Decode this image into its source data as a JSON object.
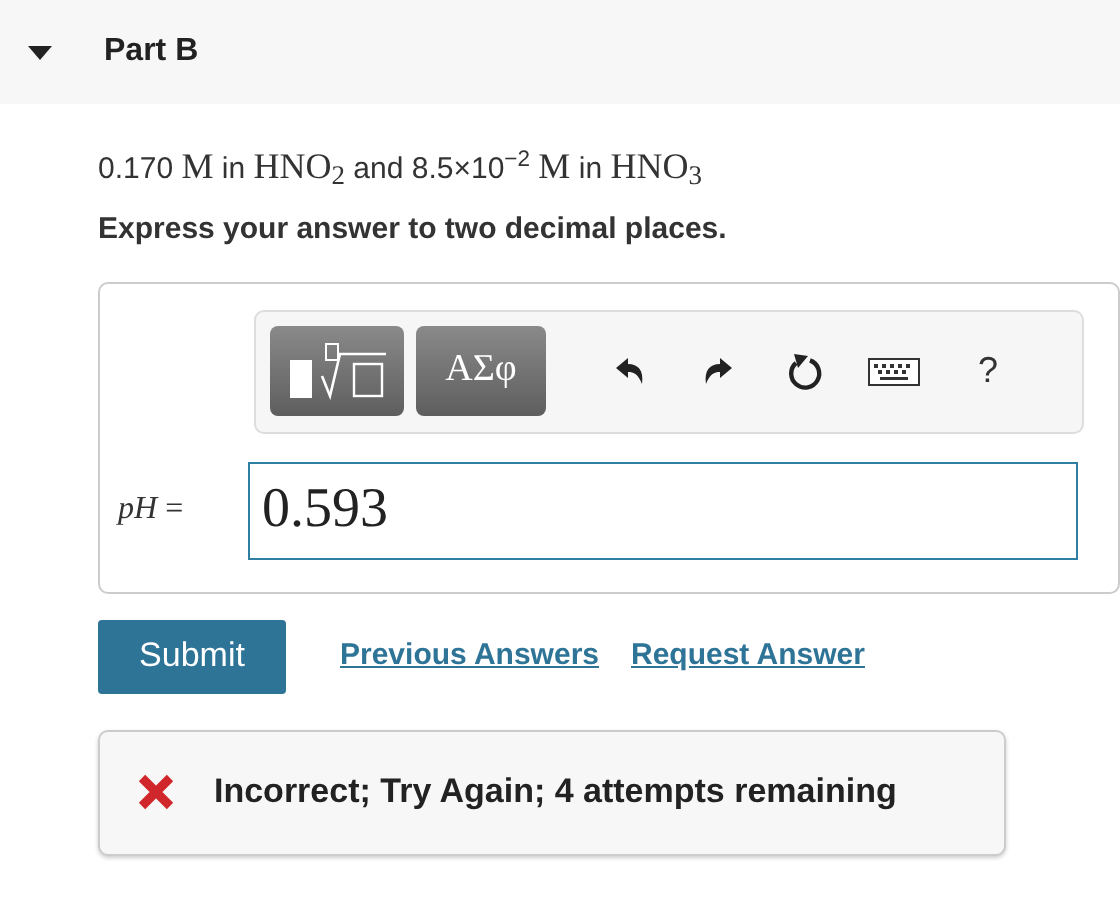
{
  "part": {
    "title": "Part B",
    "expanded": true
  },
  "problem": [
    {
      "text": "0.170 ",
      "kind": "text"
    },
    {
      "text": "M",
      "kind": "math"
    },
    {
      "text": " in ",
      "kind": "text"
    },
    {
      "text": "HNO$_{2}$",
      "kind": "math"
    },
    {
      "text": " and 8.5×10$^{−2}$ ",
      "kind": "text"
    },
    {
      "text": "M",
      "kind": "math"
    },
    {
      "text": " in ",
      "kind": "text"
    },
    {
      "text": "HNO$_{3}$",
      "kind": "math"
    }
  ],
  "instruction": "Express your answer to two decimal places.",
  "toolbar": [
    {
      "kind": "templates"
    },
    {
      "kind": "symbols",
      "label": "ΑΣφ"
    },
    {
      "kind": "undo"
    },
    {
      "kind": "redo"
    },
    {
      "kind": "reset"
    },
    {
      "kind": "keyboard"
    },
    {
      "kind": "help",
      "label": "?"
    }
  ],
  "answer": {
    "label": "*pH* =",
    "value": "0.593"
  },
  "submit": "Submit",
  "links": [
    "Previous Answers",
    "Request Answer"
  ],
  "feedback": {
    "kind": "incorrect",
    "text": "Incorrect; Try Again; 4 attempts remaining"
  }
}
